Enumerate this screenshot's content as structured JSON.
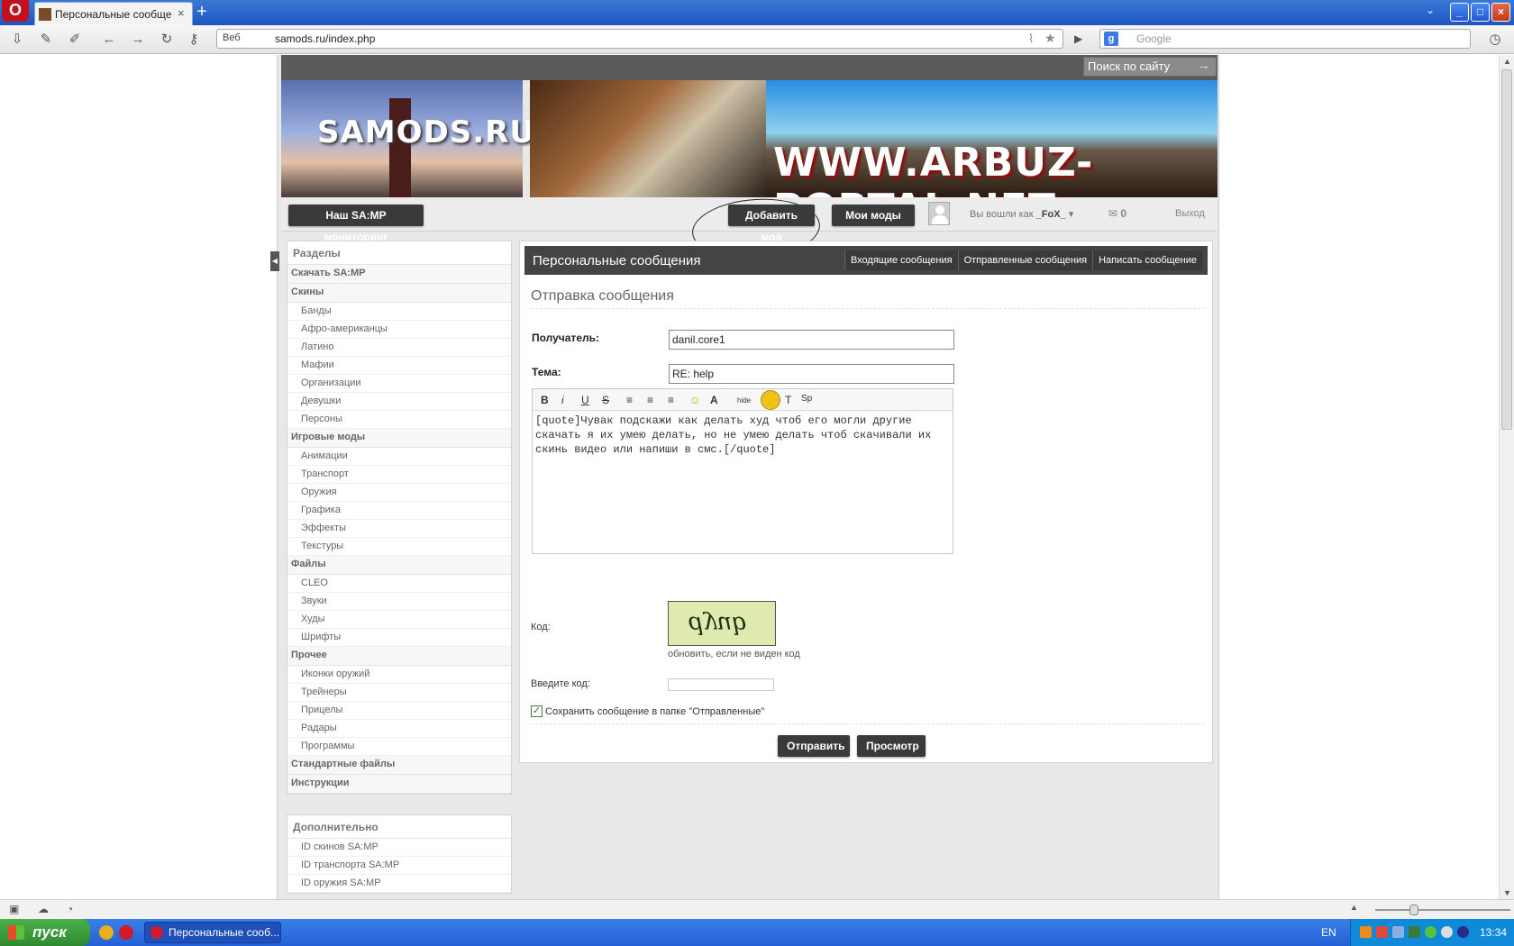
{
  "browser": {
    "tab_title": "Персональные сообще...",
    "tab_close": "×",
    "new_tab": "+",
    "address_mode": "Веб",
    "url": "samods.ru/index.php",
    "search_engine_placeholder": "Google",
    "window_controls": [
      "_",
      "□",
      "×"
    ]
  },
  "site": {
    "search_placeholder": "Поиск по сайту",
    "banner_left_text": "SAMODS.RU",
    "banner_right_text": "WWW.ARBUZ-PORTAL.NET",
    "nav": {
      "monitor_button": "Наш SA:MP мониторинг",
      "add_mod_button": "Добавить мод",
      "my_mods_button": "Мои моды",
      "logged_in_prefix": "Вы вошли как",
      "username": "_FoX_",
      "message_count": "0",
      "logout": "Выход"
    },
    "sidebar": {
      "title": "Разделы",
      "sections": [
        {
          "label": "Скачать SA:MP",
          "items": []
        },
        {
          "label": "Скины",
          "items": [
            "Банды",
            "Афро-американцы",
            "Латино",
            "Мафии",
            "Организации",
            "Девушки",
            "Персоны"
          ]
        },
        {
          "label": "Игровые моды",
          "items": [
            "Анимации",
            "Транспорт",
            "Оружия",
            "Графика",
            "Эффекты",
            "Текстуры"
          ]
        },
        {
          "label": "Файлы",
          "items": [
            "CLEO",
            "Звуки",
            "Худы",
            "Шрифты"
          ]
        },
        {
          "label": "Прочее",
          "items": [
            "Иконки оружий",
            "Трейнеры",
            "Прицелы",
            "Радары",
            "Программы"
          ]
        },
        {
          "label": "Стандартные файлы",
          "items": []
        },
        {
          "label": "Инструкции",
          "items": []
        }
      ]
    },
    "sidebar2": {
      "title": "Дополнительно",
      "items": [
        "ID скинов SA:MP",
        "ID транспорта SA:MP",
        "ID оружия SA:MP"
      ]
    },
    "pm": {
      "title": "Персональные сообщения",
      "tabs": [
        "Входящие сообщения",
        "Отправленные сообщения",
        "Написать сообщение"
      ],
      "form_title": "Отправка сообщения",
      "recipient_label": "Получатель:",
      "recipient_value": "danil.core1",
      "subject_label": "Тема:",
      "subject_value": "RE: help",
      "editor_buttons": [
        "B",
        "i",
        "U",
        "S",
        "≡",
        "≡",
        "≡",
        "☺",
        "A",
        "hide",
        "T",
        "Sp"
      ],
      "message_text": "[quote]Чувак подскажи как делать худ чтоб его могли другие скачать я их умею делать, но не умею делать чтоб скачивали их скинь видео или напиши в смс.[/quote]",
      "code_label": "Код:",
      "captcha_text": "dyub",
      "refresh_text": "обновить, если не виден код",
      "enter_code_label": "Введите код:",
      "save_label": "Сохранить сообщение в папке \"Отправленные\"",
      "save_checked": true,
      "send_button": "Отправить",
      "preview_button": "Просмотр"
    }
  },
  "taskbar": {
    "start_label": "пуск",
    "task_item": "Персональные сооб...",
    "lang": "EN",
    "clock": "13:34"
  }
}
